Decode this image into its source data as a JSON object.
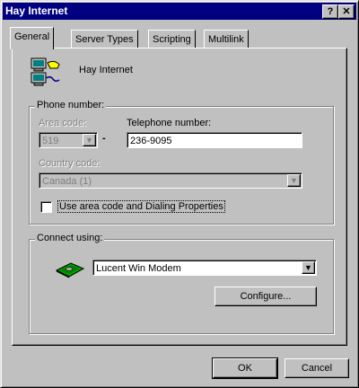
{
  "window": {
    "title": "Hay Internet",
    "help_btn": "?",
    "close_btn": "✕"
  },
  "tabs": [
    {
      "label": "General",
      "active": true
    },
    {
      "label": "Server Types",
      "active": false
    },
    {
      "label": "Scripting",
      "active": false
    },
    {
      "label": "Multilink",
      "active": false
    }
  ],
  "connection": {
    "name": "Hay Internet",
    "icon": "connection-icon"
  },
  "phone": {
    "group_label": "Phone number:",
    "area_code_label": "Area code:",
    "area_code_value": "519",
    "dash": "-",
    "telephone_label": "Telephone number:",
    "telephone_value": "236-9095",
    "country_label": "Country code:",
    "country_value": "Canada (1)",
    "use_area_code_label": "Use area code and Dialing Properties",
    "use_area_code_checked": false
  },
  "connect": {
    "group_label": "Connect using:",
    "modem_value": "Lucent Win Modem",
    "modem_icon": "modem-icon",
    "configure_label": "Configure..."
  },
  "buttons": {
    "ok": "OK",
    "cancel": "Cancel"
  }
}
